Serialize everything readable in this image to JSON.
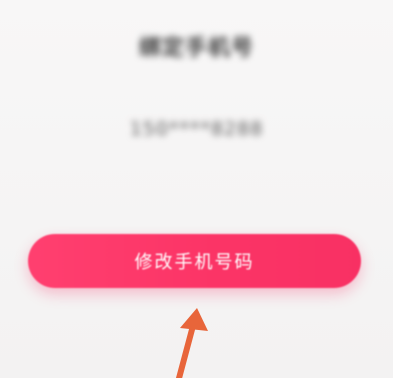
{
  "account": {
    "title_text": "绑定手机号",
    "phone_masked": "150****8288"
  },
  "actions": {
    "change_phone_label": "修改手机号码"
  },
  "annotation": {
    "arrow_icon": "up-arrow-icon",
    "arrow_color": "#e8653a"
  },
  "theme": {
    "accent": "#fb3466",
    "background": "#f6f5f5"
  }
}
